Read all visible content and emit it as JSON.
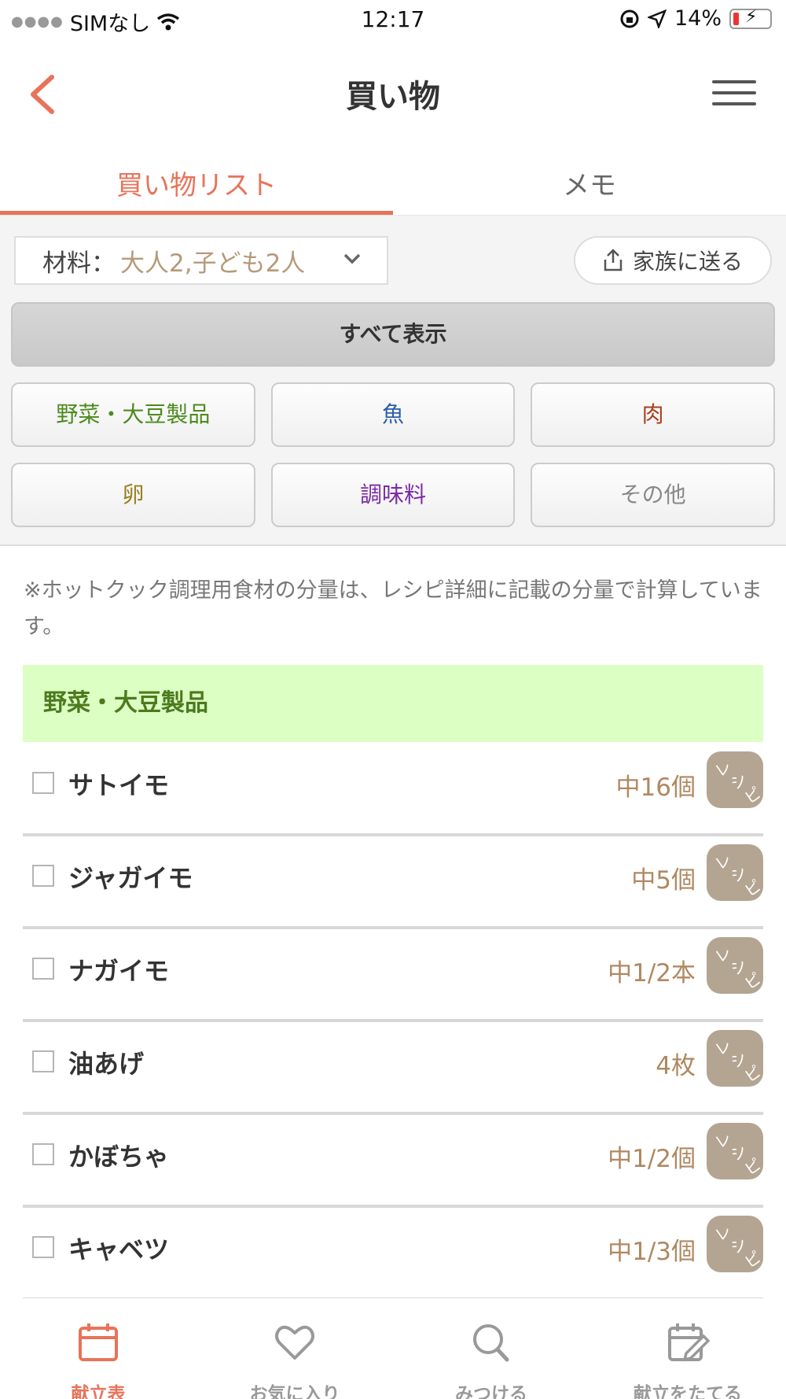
{
  "status_bar": {
    "carrier": "SIMなし",
    "time": "12:17",
    "battery": "14%"
  },
  "header": {
    "title": "買い物"
  },
  "tabs": [
    {
      "label": "買い物リスト",
      "active": true
    },
    {
      "label": "メモ",
      "active": false
    }
  ],
  "filters": {
    "servings_label": "材料：",
    "servings_value": "大人2,子ども2人",
    "send_label": "家族に送る",
    "show_all_label": "すべて表示",
    "categories": [
      {
        "label": "野菜・大豆製品",
        "color": "#4c8a1e"
      },
      {
        "label": "魚",
        "color": "#2b5fa8"
      },
      {
        "label": "肉",
        "color": "#a8421e"
      },
      {
        "label": "卵",
        "color": "#9a8020"
      },
      {
        "label": "調味料",
        "color": "#7a2aa8"
      },
      {
        "label": "その他",
        "color": "#888888"
      }
    ]
  },
  "note": "※ホットクック調理用食材の分量は、レシピ詳細に記載の分量で計算しています。",
  "section": {
    "title": "野菜・大豆製品"
  },
  "recipe_badge": [
    "レ",
    "シ",
    "ピ"
  ],
  "items": [
    {
      "name": "サトイモ",
      "qty": "中16個"
    },
    {
      "name": "ジャガイモ",
      "qty": "中5個"
    },
    {
      "name": "ナガイモ",
      "qty": "中1/2本"
    },
    {
      "name": "油あげ",
      "qty": "4枚"
    },
    {
      "name": "かぼちゃ",
      "qty": "中1/2個"
    },
    {
      "name": "キャベツ",
      "qty": "中1/3個"
    }
  ],
  "bottom_nav": [
    {
      "label": "献立表",
      "icon": "calendar-icon",
      "active": true
    },
    {
      "label": "お気に入り",
      "icon": "heart-icon",
      "active": false
    },
    {
      "label": "みつける",
      "icon": "search-icon",
      "active": false
    },
    {
      "label": "献立をたてる",
      "icon": "edit-calendar-icon",
      "active": false
    }
  ],
  "colors": {
    "accent": "#e8735a",
    "qty": "#b08861",
    "section_bg": "#dcffc4"
  }
}
